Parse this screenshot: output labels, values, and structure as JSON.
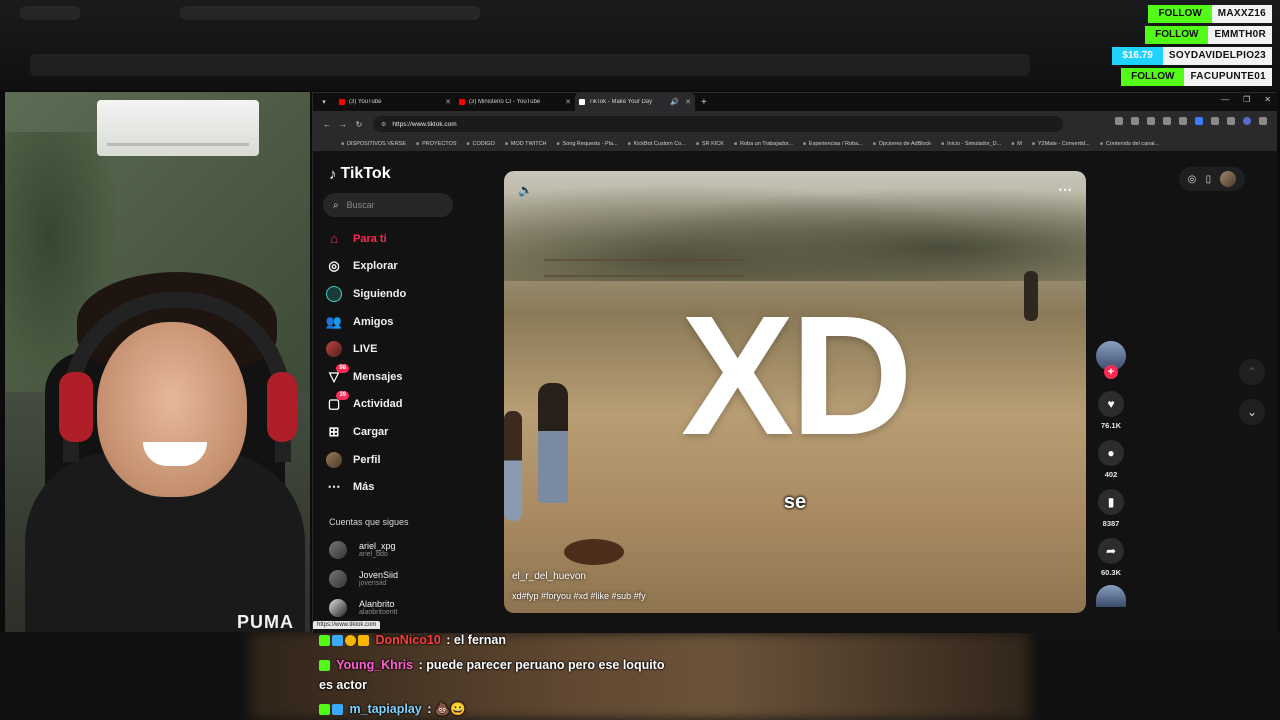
{
  "alerts": [
    {
      "tag": "FOLLOW",
      "user": "MAXXZ16"
    },
    {
      "tag": "FOLLOW",
      "user": "EMMTH0R"
    },
    {
      "tag": "$16.79",
      "user": "SOYDAVIDELPIO23"
    },
    {
      "tag": "FOLLOW",
      "user": "FACUPUNTE01"
    }
  ],
  "webcam": {
    "shirt_brand": "PUMA"
  },
  "browser": {
    "tabs": [
      {
        "label": "(3) YouTube",
        "color": "#ff0000"
      },
      {
        "label": "(3) Ministerio CI - YouTube",
        "color": "#ff0000"
      },
      {
        "label": "TikTok - Make Your Day",
        "color": "#ffffff"
      }
    ],
    "url": "https://www.tiktok.com",
    "bookmarks": [
      "DISPOSITIVOS VERSE",
      "PROYECTOS",
      "CODIGO",
      "MOD TWITCH",
      "Song Requests - Pla...",
      "KickBot Custom Co...",
      "SR KICK",
      "Roba un Trabajador...",
      "Experiencias / Roba...",
      "Opciones de AdBlock",
      "Inicio - Simulador_D...",
      "M",
      "Y2Mate - Convertid...",
      "Contenido del canal..."
    ]
  },
  "tiktok": {
    "brand": "TikTok",
    "search_placeholder": "Buscar",
    "nav": [
      {
        "label": "Para ti",
        "icon": "home-icon"
      },
      {
        "label": "Explorar",
        "icon": "compass-icon"
      },
      {
        "label": "Siguiendo",
        "icon": "following-icon"
      },
      {
        "label": "Amigos",
        "icon": "friends-icon"
      },
      {
        "label": "LIVE",
        "icon": "live-icon"
      },
      {
        "label": "Mensajes",
        "icon": "messages-icon",
        "badge": "98"
      },
      {
        "label": "Actividad",
        "icon": "activity-icon",
        "badge": "39"
      },
      {
        "label": "Cargar",
        "icon": "upload-icon"
      },
      {
        "label": "Perfil",
        "icon": "profile-icon"
      },
      {
        "label": "Más",
        "icon": "more-icon"
      }
    ],
    "following_heading": "Cuentas que sigues",
    "following": [
      {
        "name": "ariel_xpg",
        "handle": "ariel_bdo"
      },
      {
        "name": "JovenSiid",
        "handle": "jovensiid"
      },
      {
        "name": "Alanbrito",
        "handle": "alanbritoentt"
      }
    ],
    "status_url": "https://www.tiktok.com",
    "video": {
      "overlay_text": "XD",
      "caption": "se",
      "author": "el_r_del_huevon",
      "tags": "xd#fyp #foryou #xd #like #sub #fy"
    },
    "actions": {
      "likes": "76.1K",
      "comments": "402",
      "saves": "8387",
      "shares": "60.3K"
    }
  },
  "chat": [
    {
      "user": "DonNico10",
      "user_color": "#ff3d3d",
      "message": ": el fernan",
      "badges": [
        "#53fc18",
        "#3da8ff",
        "#f7b500",
        "#f7b500"
      ]
    },
    {
      "user": "Young_Khris",
      "user_color": "#ff5fd2",
      "message": ": puede parecer peruano pero ese loquito",
      "badges": [
        "#53fc18"
      ]
    },
    {
      "user": "",
      "user_color": "#ffffff",
      "message": "es actor",
      "badges": []
    },
    {
      "user": "m_tapiaplay",
      "user_color": "#7fd4ff",
      "message": ": 💩😀",
      "badges": [
        "#53fc18",
        "#3da8ff"
      ]
    }
  ]
}
